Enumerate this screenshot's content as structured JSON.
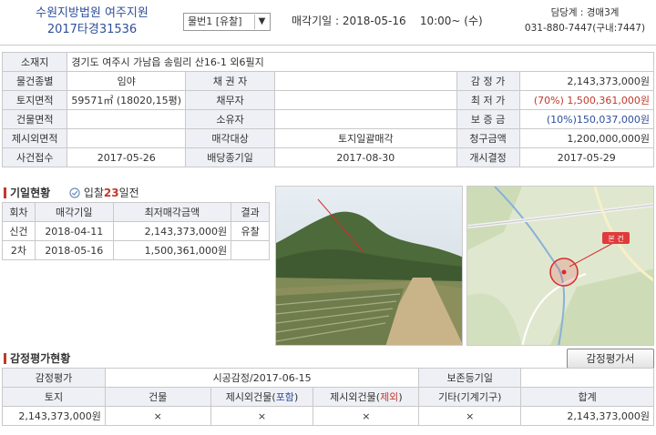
{
  "header": {
    "court_name": "수원지방법원 여주지원",
    "case_number": "2017타경31536",
    "item_select": "물번1 [유찰]",
    "sale_date_label": "매각기일",
    "sale_date_value": ": 2018-05-16    10:00~ (수)",
    "dept_label": "담당계",
    "dept_value": ": 경매3계",
    "phone": "031-880-7447(구내:7447)"
  },
  "info": {
    "location_label": "소재지",
    "location_value": "경기도 여주시 가남읍 송림리 산16-1 외6필지",
    "type_label": "물건종별",
    "type_value": "임야",
    "creditor_label": "채 권 자",
    "creditor_value": "",
    "appraisal_label": "감 정 가",
    "appraisal_value": "2,143,373,000원",
    "land_area_label": "토지면적",
    "land_area_value": "59571㎡ (18020,15평)",
    "debtor_label": "채무자",
    "debtor_value": "",
    "min_price_label": "최 저 가",
    "min_price_pct": "(70%)",
    "min_price_value": "1,500,361,000원",
    "bldg_area_label": "건물면적",
    "bldg_area_value": "",
    "owner_label": "소유자",
    "owner_value": "",
    "deposit_label": "보 증 금",
    "deposit_value": "(10%)150,037,000원",
    "excl_area_label": "제시외면적",
    "excl_area_value": "",
    "target_label": "매각대상",
    "target_value": "토지일괄매각",
    "claim_label": "청구금액",
    "claim_value": "1,200,000,000원",
    "received_label": "사건접수",
    "received_value": "2017-05-26",
    "dividend_label": "배당종기일",
    "dividend_value": "2017-08-30",
    "start_label": "개시결정",
    "start_value": "2017-05-29"
  },
  "history": {
    "title": "기일현황",
    "days_prefix": "입찰",
    "days_num": "23",
    "days_suffix": "일전",
    "headers": [
      "회차",
      "매각기일",
      "최저매각금액",
      "결과"
    ],
    "rows": [
      [
        "신건",
        "2018-04-11",
        "2,143,373,000원",
        "유찰"
      ],
      [
        "2차",
        "2018-05-16",
        "1,500,361,000원",
        ""
      ]
    ]
  },
  "map": {
    "marker_label": "본 건"
  },
  "appraisal": {
    "title": "감정평가현황",
    "button": "감정평가서",
    "label": "감정평가",
    "agency": "시공감정/2017-06-15",
    "preserve_label": "보존등기일",
    "preserve_value": "",
    "col_land": "토지",
    "col_building": "건물",
    "col_incl_prefix": "제시외건물(",
    "col_incl_word": "포함",
    "col_excl_prefix": "제시외건물(",
    "col_excl_word": "제외",
    "col_paren_close": ")",
    "col_other": "기타(기계기구)",
    "col_total": "합계",
    "val_land": "2,143,373,000원",
    "val_building": "×",
    "val_incl": "×",
    "val_excl": "×",
    "val_other": "×",
    "val_total": "2,143,373,000원"
  },
  "colors": {
    "accent_blue": "#2e4f9a",
    "accent_red": "#c0392b",
    "header_cell": "#eef0f5"
  }
}
